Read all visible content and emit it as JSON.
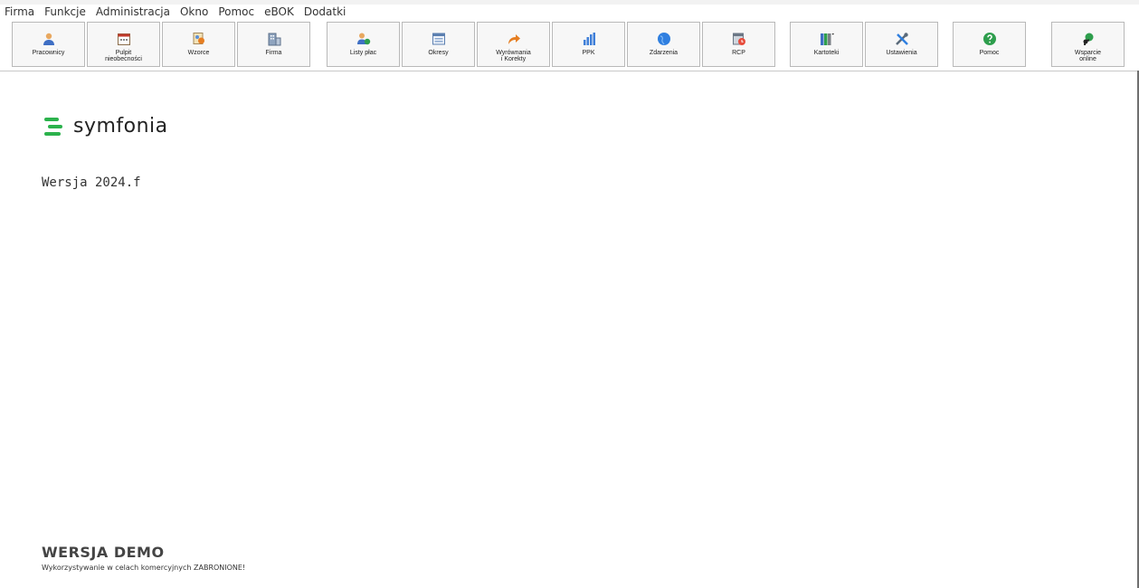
{
  "menu": [
    "Firma",
    "Funkcje",
    "Administracja",
    "Okno",
    "Pomoc",
    "eBOK",
    "Dodatki"
  ],
  "toolbar": [
    {
      "id": "pracownicy",
      "label": "Pracownicy",
      "icon": "person-icon"
    },
    {
      "id": "pulpit",
      "label": "Pulpit\nnieobecności",
      "icon": "calendar-icon"
    },
    {
      "id": "wzorce",
      "label": "Wzorce",
      "icon": "templates-icon"
    },
    {
      "id": "firma",
      "label": "Firma",
      "icon": "building-icon"
    },
    {
      "id": "listy",
      "label": "Listy płac",
      "icon": "payroll-person-icon"
    },
    {
      "id": "okresy",
      "label": "Okresy",
      "icon": "periods-window-icon"
    },
    {
      "id": "wyrownania",
      "label": "Wyrównania\ni Korekty",
      "icon": "arrow-redo-icon"
    },
    {
      "id": "ppk",
      "label": "PPK",
      "icon": "bar-chart-icon"
    },
    {
      "id": "zdarzenia",
      "label": "Zdarzenia",
      "icon": "globe-icon"
    },
    {
      "id": "rcp",
      "label": "RCP",
      "icon": "clock-card-icon"
    },
    {
      "id": "kartoteki",
      "label": "Kartoteki",
      "icon": "binders-icon"
    },
    {
      "id": "ustawienia",
      "label": "Ustawienia",
      "icon": "tools-icon"
    },
    {
      "id": "pomoc",
      "label": "Pomoc",
      "icon": "help-icon"
    },
    {
      "id": "wsparcie",
      "label": "Wsparcie\nonline",
      "icon": "support-online-icon"
    }
  ],
  "brand": {
    "name": "symfonia",
    "accent": "#2bb24c"
  },
  "version": "Wersja 2024.f",
  "demo": {
    "title": "WERSJA DEMO",
    "subtitle": "Wykorzystywanie w celach komercyjnych ZABRONIONE!"
  }
}
